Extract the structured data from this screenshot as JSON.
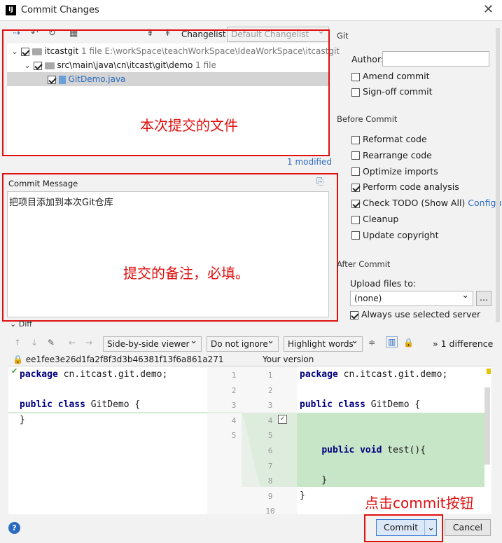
{
  "window": {
    "title": "Commit Changes",
    "app_icon": "IJ"
  },
  "toolbar": {
    "changelist_label": "Changelist:",
    "changelist_value": "Default Changelist"
  },
  "tree": {
    "root": {
      "name": "itcastgit",
      "count": "1 file",
      "path": "E:\\workSpace\\teachWorkSpace\\IdeaWorkSpace\\itcastgit"
    },
    "folder": {
      "name": "src\\main\\java\\cn\\itcast\\git\\demo",
      "count": "1 file"
    },
    "file": {
      "name": "GitDemo.java"
    },
    "modified": "1 modified"
  },
  "annotations": {
    "files": "本次提交的文件",
    "message": "提交的备注，必填。",
    "commit": "点击commit按钮"
  },
  "commit_message": {
    "label": "Commit Message",
    "text": "把项目添加到本次Git仓库"
  },
  "git": {
    "section": "Git",
    "author_label": "Author:",
    "author_value": "",
    "amend": "Amend commit",
    "signoff": "Sign-off commit"
  },
  "before_commit": {
    "section": "Before Commit",
    "options": [
      {
        "label": "Reformat code",
        "checked": false
      },
      {
        "label": "Rearrange code",
        "checked": false
      },
      {
        "label": "Optimize imports",
        "checked": false
      },
      {
        "label": "Perform code analysis",
        "checked": true
      },
      {
        "label": "Check TODO (Show All)",
        "checked": true
      },
      {
        "label": "Cleanup",
        "checked": false
      },
      {
        "label": "Update copyright",
        "checked": false
      }
    ],
    "configure": "Configure"
  },
  "after_commit": {
    "section": "After Commit",
    "upload_label": "Upload files to:",
    "upload_value": "(none)",
    "browse": "...",
    "always_use": "Always use selected server"
  },
  "diff": {
    "section": "Diff",
    "viewer": "Side-by-side viewer",
    "ignore": "Do not ignore",
    "highlight": "Highlight words",
    "differences": "1 difference",
    "left_hash": "ee1fee3e26d1fa2f8f3d3b46381f13f6a861a271",
    "right_title": "Your version",
    "left_lines": [
      "package cn.itcast.git.demo;",
      "",
      "public class GitDemo {",
      "}"
    ],
    "right_lines": [
      "package cn.itcast.git.demo;",
      "",
      "public class GitDemo {",
      "",
      "",
      "    public void test(){",
      "",
      "    }",
      "}",
      ""
    ],
    "left_nums": [
      "1",
      "2",
      "3",
      "4",
      "5"
    ],
    "right_nums": [
      "1",
      "2",
      "3",
      "4",
      "5",
      "6",
      "7",
      "8",
      "9",
      "10"
    ]
  },
  "buttons": {
    "commit": "Commit",
    "cancel": "Cancel",
    "help": "?"
  },
  "colors": {
    "accent": "#2b6bbf",
    "annotation": "#e01010",
    "diff_added": "#c7e6c7",
    "selected_row": "#d4d4d4"
  }
}
